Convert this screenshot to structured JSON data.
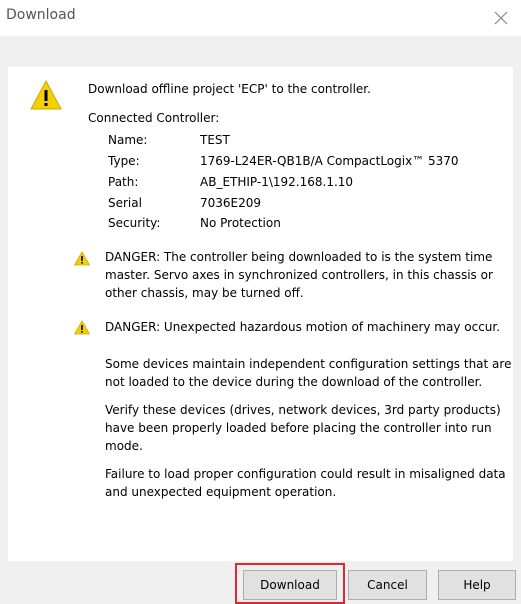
{
  "window": {
    "title": "Download"
  },
  "icons": {
    "close": "close-icon",
    "warning": "warning-icon",
    "warning_color": "#f5d000"
  },
  "main": {
    "intro": "Download offline project 'ECP' to the controller.",
    "connected_heading": "Connected Controller:",
    "controller": [
      {
        "label": "Name:",
        "value": "TEST"
      },
      {
        "label": "Type:",
        "value": "1769-L24ER-QB1B/A CompactLogix™ 5370"
      },
      {
        "label": "Path:",
        "value": "AB_ETHIP-1\\192.168.1.10"
      },
      {
        "label": "Serial",
        "value": "7036E209"
      },
      {
        "label": "Security:",
        "value": "No Protection"
      }
    ],
    "danger1": [
      "DANGER: The controller being downloaded to is the system time",
      "master.  Servo axes in synchronized controllers, in this chassis or",
      "other chassis, may be turned off."
    ],
    "danger2": "DANGER: Unexpected hazardous motion of machinery may occur.",
    "para1": [
      "Some devices maintain independent configuration settings that are",
      "not loaded to the device during the download of the controller."
    ],
    "para2": [
      "Verify these devices (drives, network devices, 3rd party products)",
      "have been properly loaded before placing the controller into run",
      "mode."
    ],
    "para3": [
      "Failure to load proper configuration could result in misaligned data",
      "and unexpected equipment operation."
    ]
  },
  "buttons": {
    "download": "Download",
    "cancel": "Cancel",
    "help": "Help"
  },
  "colors": {
    "highlight": "#e0262f"
  }
}
